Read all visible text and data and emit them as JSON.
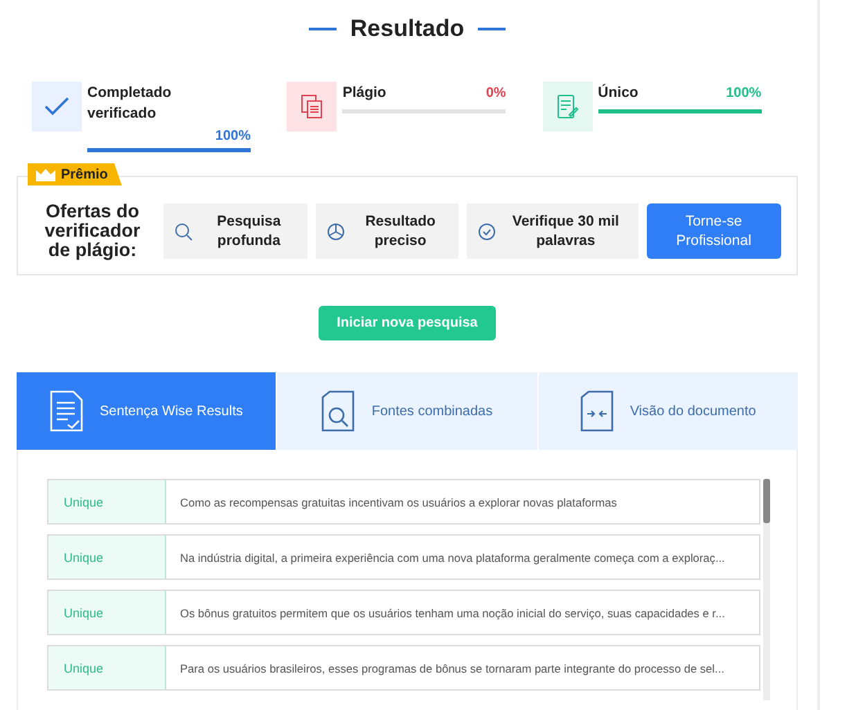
{
  "title": "Resultado",
  "stats": [
    {
      "kind": "check",
      "label": "Completado verificado",
      "value": "100%",
      "level": 1,
      "color": "#2f74d8"
    },
    {
      "kind": "copy",
      "label": "Plágio",
      "value": "0%",
      "level": 0,
      "color": "#e0424f"
    },
    {
      "kind": "note",
      "label": "Único",
      "value": "100%",
      "level": 1,
      "color": "#1fbf8a"
    }
  ],
  "premium": {
    "badge": "Prêmio",
    "heading": "Ofertas do verificador de plágio:",
    "features": [
      {
        "kind": "search",
        "label": "Pesquisa profunda"
      },
      {
        "kind": "pie",
        "label": "Resultado preciso"
      },
      {
        "kind": "check",
        "label": "Verifique 30 mil palavras"
      }
    ],
    "cta": "Torne-se Profissional"
  },
  "new_search_button": "Iniciar nova pesquisa",
  "tabs": [
    {
      "kind": "sentence",
      "label": "Sentença Wise Results",
      "selected": true
    },
    {
      "kind": "sources",
      "label": "Fontes combinadas",
      "selected": false
    },
    {
      "kind": "document",
      "label": "Visão do documento",
      "selected": false
    }
  ],
  "results": [
    {
      "status": "Unique",
      "text": "Como as recompensas gratuitas incentivam os usuários a explorar novas plataformas"
    },
    {
      "status": "Unique",
      "text": "Na indústria digital, a primeira experiência com uma nova plataforma geralmente começa com a exploraç..."
    },
    {
      "status": "Unique",
      "text": "Os bônus gratuitos permitem que os usuários tenham uma noção inicial do serviço, suas capacidades e r..."
    },
    {
      "status": "Unique",
      "text": "Para os usuários brasileiros, esses programas de bônus se tornaram parte integrante do processo de sel..."
    }
  ]
}
